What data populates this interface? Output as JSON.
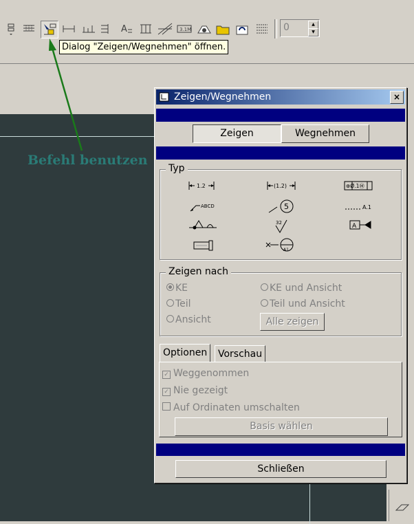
{
  "toolbar": {
    "icons": [
      "list-icon",
      "table-icon",
      "show-remove-icon",
      "dimension-icon",
      "ordinate-icon",
      "stack-icon",
      "text-icon",
      "datum-icon",
      "slope-icon",
      "scale-icon",
      "hatch-icon",
      "folder-icon",
      "regen-icon",
      "layers-icon"
    ],
    "spin_value": "0"
  },
  "tooltip": "Dialog \"Zeigen/Wegnehmen\" öffnen.",
  "annotation": {
    "text": "Befehl benutzen",
    "color": "#2a7b76",
    "arrow_color": "#1a7a1a"
  },
  "dialog": {
    "title": "Zeigen/Wegnehmen",
    "close": "×",
    "mode_buttons": {
      "show": "Zeigen",
      "remove": "Wegnehmen",
      "selected": "Zeigen"
    },
    "type_group": {
      "label": "Typ",
      "symbols": {
        "dim": "1.2",
        "refdim": "(1.2)",
        "gtol": "⊕Ø.1Ⓜ",
        "note": "ABCD",
        "balloon": "5",
        "axis": "A.1",
        "surface": "32",
        "datum": "A"
      }
    },
    "show_by": {
      "label": "Zeigen nach",
      "options": [
        "KE",
        "KE und Ansicht",
        "Teil",
        "Teil und Ansicht",
        "Ansicht"
      ],
      "selected": "KE",
      "show_all": "Alle zeigen"
    },
    "tabs": {
      "options": "Optionen",
      "preview": "Vorschau",
      "active": "Optionen"
    },
    "options": {
      "removed": "Weggenommen",
      "removed_checked": true,
      "never_shown": "Nie gezeigt",
      "never_shown_checked": true,
      "toggle_ordinates": "Auf Ordinaten umschalten",
      "toggle_ordinates_checked": false,
      "choose_base": "Basis wählen"
    },
    "close_button": "Schließen"
  }
}
